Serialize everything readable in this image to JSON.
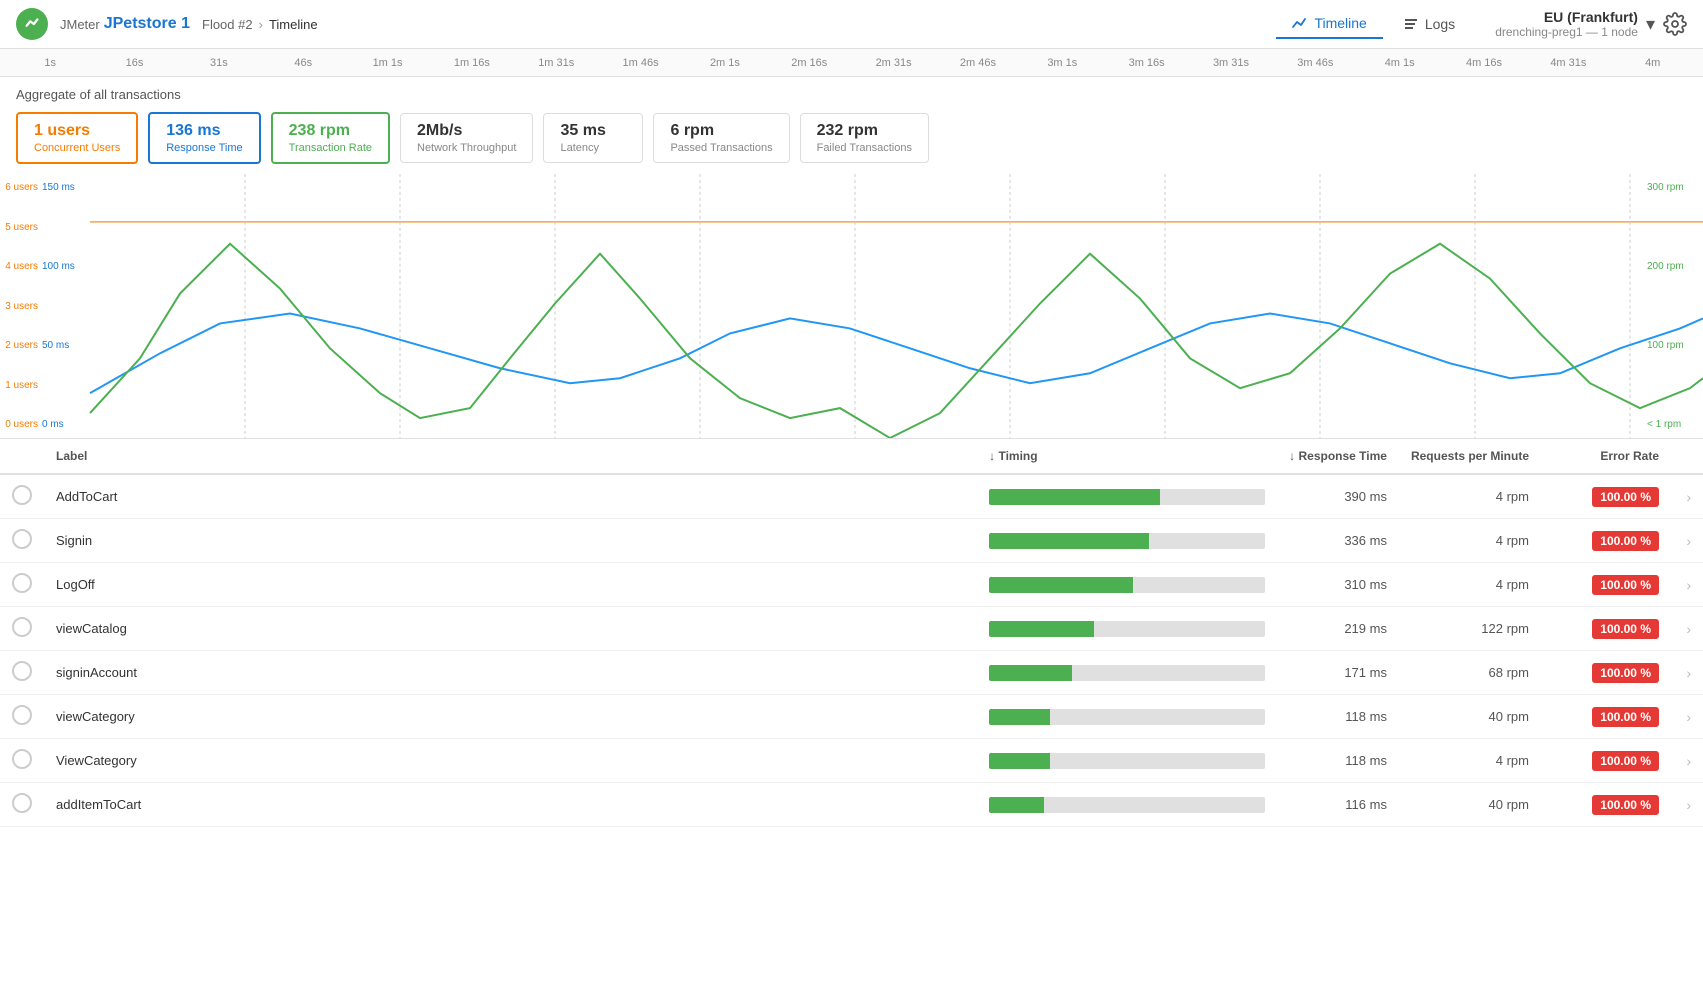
{
  "header": {
    "brand": "JMeter",
    "title": "JPetstore 1",
    "breadcrumb_parent": "Flood #2",
    "breadcrumb_current": "Timeline",
    "nav": [
      {
        "id": "timeline",
        "label": "Timeline",
        "active": true
      },
      {
        "id": "logs",
        "label": "Logs",
        "active": false
      }
    ],
    "region": {
      "name": "EU (Frankfurt)",
      "sub": "drenching-preg1 — 1 node"
    }
  },
  "ruler_ticks": [
    "1s",
    "16s",
    "31s",
    "46s",
    "1m 1s",
    "1m 16s",
    "1m 31s",
    "1m 46s",
    "2m 1s",
    "2m 16s",
    "2m 31s",
    "2m 46s",
    "3m 1s",
    "3m 16s",
    "3m 31s",
    "3m 46s",
    "4m 1s",
    "4m 16s",
    "4m 31s",
    "4m"
  ],
  "aggregate_label": "Aggregate of all transactions",
  "metrics": [
    {
      "id": "concurrent-users",
      "value": "1 users",
      "label": "Concurrent Users",
      "color": "orange",
      "border": "active-orange"
    },
    {
      "id": "response-time",
      "value": "136 ms",
      "label": "Response Time",
      "color": "blue",
      "border": "active-blue"
    },
    {
      "id": "transaction-rate",
      "value": "238 rpm",
      "label": "Transaction Rate",
      "color": "green",
      "border": "active-green"
    },
    {
      "id": "network-throughput",
      "value": "2Mb/s",
      "label": "Network Throughput",
      "color": "dark",
      "border": ""
    },
    {
      "id": "latency",
      "value": "35 ms",
      "label": "Latency",
      "color": "dark",
      "border": ""
    },
    {
      "id": "passed-transactions",
      "value": "6 rpm",
      "label": "Passed Transactions",
      "color": "dark",
      "border": ""
    },
    {
      "id": "failed-transactions",
      "value": "232 rpm",
      "label": "Failed Transactions",
      "color": "dark",
      "border": ""
    }
  ],
  "chart": {
    "y_axis_users": [
      "6 users",
      "5 users",
      "4 users",
      "3 users",
      "2 users",
      "1 users",
      "0 users"
    ],
    "y_axis_ms": [
      "150 ms",
      "100 ms",
      "50 ms",
      "0 ms"
    ],
    "y_axis_rpm": [
      "300 rpm",
      "200 rpm",
      "100 rpm",
      "< 1 rpm"
    ]
  },
  "table": {
    "columns": [
      {
        "id": "check",
        "label": ""
      },
      {
        "id": "label",
        "label": "Label"
      },
      {
        "id": "timing",
        "label": "↓ Timing",
        "sortable": true
      },
      {
        "id": "response",
        "label": "↓ Response Time",
        "sortable": true
      },
      {
        "id": "rpm",
        "label": "Requests per Minute"
      },
      {
        "id": "error",
        "label": "Error Rate"
      },
      {
        "id": "arrow",
        "label": ""
      }
    ],
    "rows": [
      {
        "label": "AddToCart",
        "timing_pct": 62,
        "response": "390 ms",
        "rpm": "4 rpm",
        "error": "100.00 %"
      },
      {
        "label": "Signin",
        "timing_pct": 58,
        "response": "336 ms",
        "rpm": "4 rpm",
        "error": "100.00 %"
      },
      {
        "label": "LogOff",
        "timing_pct": 52,
        "response": "310 ms",
        "rpm": "4 rpm",
        "error": "100.00 %"
      },
      {
        "label": "viewCatalog",
        "timing_pct": 38,
        "response": "219 ms",
        "rpm": "122 rpm",
        "error": "100.00 %"
      },
      {
        "label": "signinAccount",
        "timing_pct": 30,
        "response": "171 ms",
        "rpm": "68 rpm",
        "error": "100.00 %"
      },
      {
        "label": "viewCategory",
        "timing_pct": 22,
        "response": "118 ms",
        "rpm": "40 rpm",
        "error": "100.00 %"
      },
      {
        "label": "ViewCategory",
        "timing_pct": 22,
        "response": "118 ms",
        "rpm": "4 rpm",
        "error": "100.00 %"
      },
      {
        "label": "addItemToCart",
        "timing_pct": 20,
        "response": "116 ms",
        "rpm": "40 rpm",
        "error": "100.00 %"
      }
    ]
  }
}
